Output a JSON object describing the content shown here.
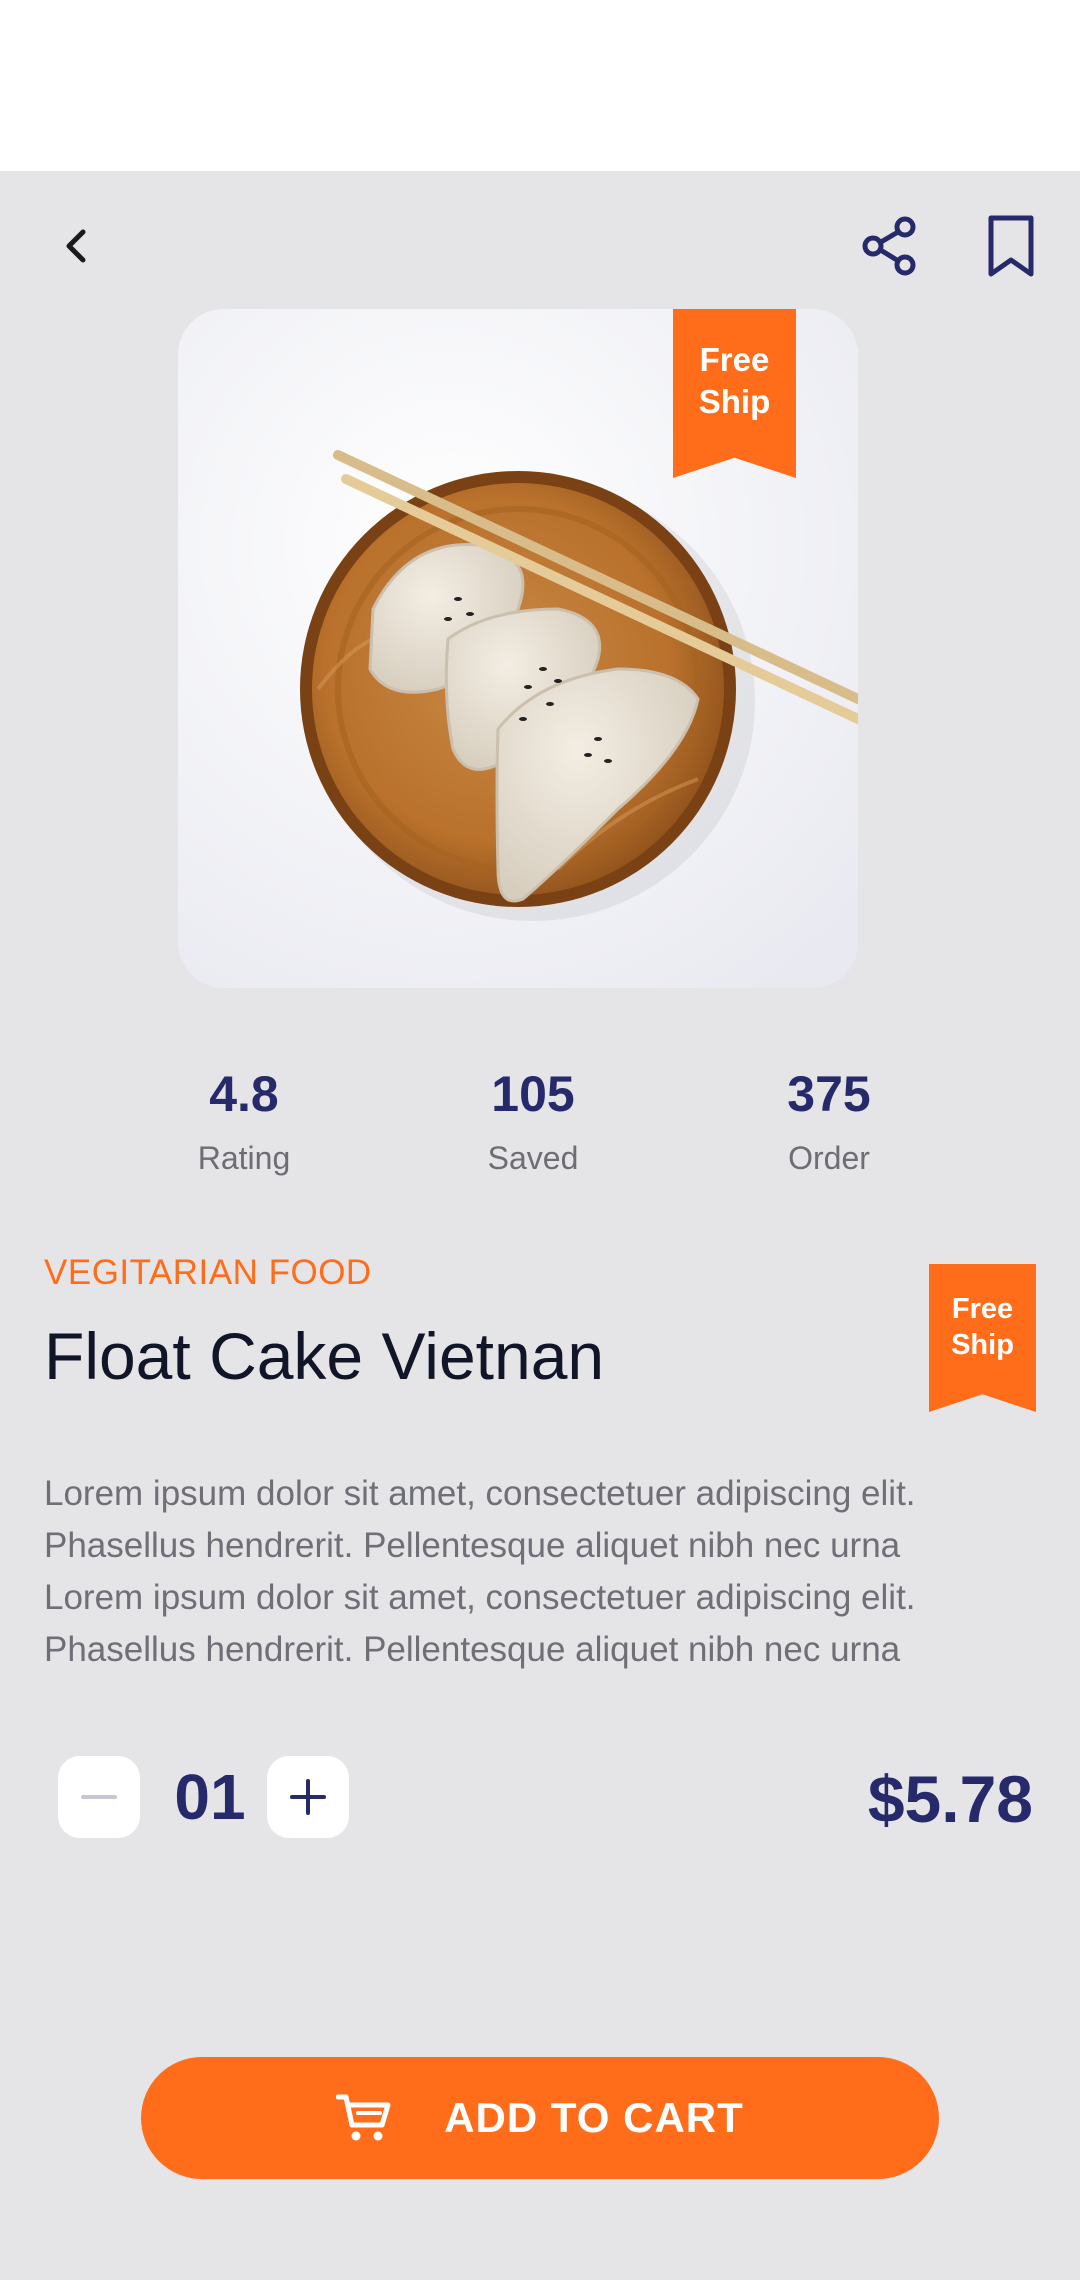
{
  "product": {
    "badge_text": [
      "Free",
      "Ship"
    ],
    "category": "VEGITARIAN FOOD",
    "title": "Float Cake Vietnan",
    "description_lines": [
      "Lorem ipsum dolor sit amet, consectetuer adipiscing elit.",
      "Phasellus hendrerit. Pellentesque aliquet nibh nec urna",
      "Lorem ipsum dolor sit amet, consectetuer adipiscing elit.",
      "Phasellus hendrerit. Pellentesque aliquet nibh nec urna"
    ],
    "price": "$5.78",
    "image_icon": "dumplings-on-wooden-plate-photo"
  },
  "stats": [
    {
      "value": "4.8",
      "label": "Rating"
    },
    {
      "value": "105",
      "label": "Saved"
    },
    {
      "value": "375",
      "label": "Order"
    }
  ],
  "quantity": {
    "value": "01"
  },
  "cart": {
    "label": "ADD TO CART"
  },
  "icons": {
    "back": "chevron-left-icon",
    "share": "share-icon",
    "bookmark": "bookmark-icon",
    "minus": "minus-icon",
    "plus": "plus-icon",
    "cart": "cart-icon"
  },
  "colors": {
    "accent": "#ff6d1a",
    "navy": "#262a6b",
    "background": "#e5e4e6",
    "title": "#111528",
    "body_text": "#6f6f78"
  }
}
